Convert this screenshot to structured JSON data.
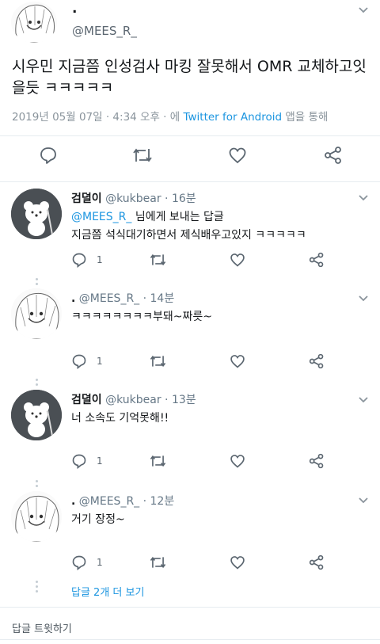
{
  "main_tweet": {
    "display_name": ".",
    "handle": "@MEES_R_",
    "text": "시우민 지금쯤 인성검사 마킹 잘못해서 OMR 교체하고잇을듯 ㅋㅋㅋㅋㅋ",
    "meta_prefix": "2019년 05월 07일 · 4:34 오후 · 에 ",
    "meta_source": "Twitter for Android",
    "meta_suffix": " 앱을 통해"
  },
  "replies": [
    {
      "display_name": "검뎔이",
      "handle": "@kukbear",
      "time": "· 16분",
      "reply_to_mention": "@MEES_R_",
      "reply_to_suffix": " 님에게 보내는 답글",
      "text": "지금쯤 석식대기하면서 제식배우고있지 ㅋㅋㅋㅋㅋ",
      "reply_count": "1"
    },
    {
      "display_name": ".",
      "handle": "@MEES_R_",
      "time": "· 14분",
      "text": "ㅋㅋㅋㅋㅋㅋㅋㅋ부돼~짜릇~",
      "reply_count": "1"
    },
    {
      "display_name": "검뎔이",
      "handle": "@kukbear",
      "time": "· 13분",
      "text": "너 소속도 기억못해!!",
      "reply_count": "1"
    },
    {
      "display_name": ".",
      "handle": "@MEES_R_",
      "time": "· 12분",
      "text": "거기 장정~",
      "reply_count": "1"
    }
  ],
  "more_replies_label": "답글 2개 더 보기",
  "compose_placeholder": "답글 트윗하기",
  "colors": {
    "link": "#1b95e0",
    "icon": "#5b6670",
    "divider": "#e6ecf0"
  }
}
